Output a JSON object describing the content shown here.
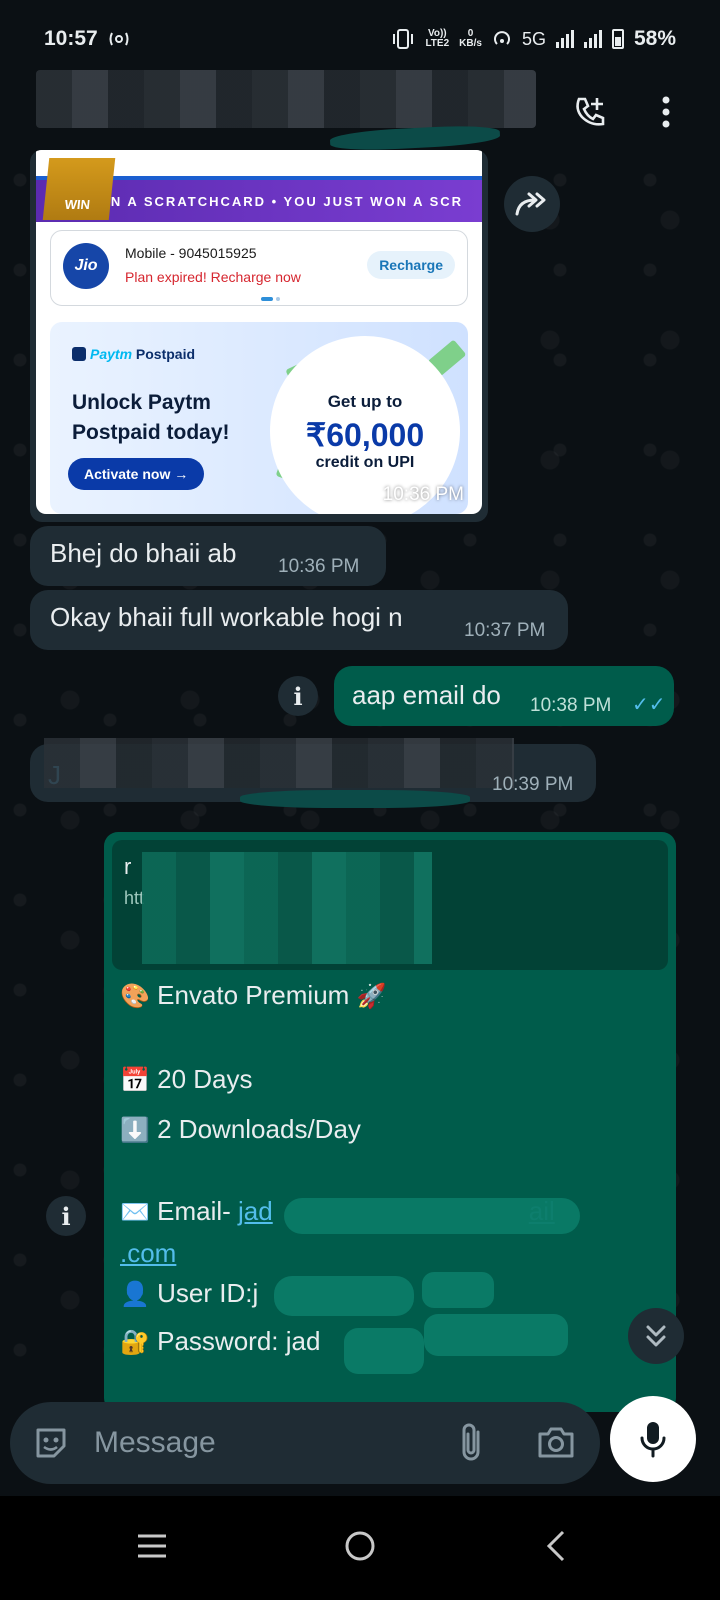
{
  "status_bar": {
    "time": "10:57",
    "volte": "Vo))",
    "lte": "LTE2",
    "speed_value": "0",
    "speed_unit": "KB/s",
    "network": "5G",
    "battery": "58%"
  },
  "media_card": {
    "ticker_text": "J   N A SCRATCHCARD • YOU JUST WON A SCR",
    "scratch_label": "WIN",
    "jio": {
      "logo": "Jio",
      "mobile": "Mobile - 9045015925",
      "status": "Plan expired! Recharge now",
      "button": "Recharge"
    },
    "paytm": {
      "brand": "Paytm",
      "product": "Postpaid",
      "headline": "Unlock Paytm Postpaid today!",
      "button": "Activate now →",
      "offer_prefix": "Get up to",
      "offer_amount": "₹60,000",
      "offer_suffix": "credit on UPI"
    },
    "time": "10:36 PM"
  },
  "messages": [
    {
      "text": "Bhej do bhaii ab",
      "time": "10:36 PM",
      "direction": "in"
    },
    {
      "text": "Okay bhaii full workable hogi n",
      "time": "10:37 PM",
      "direction": "in"
    },
    {
      "text": "aap email do",
      "time": "10:38 PM",
      "direction": "out",
      "ticks": "✓✓"
    },
    {
      "text": "J",
      "time": "10:39 PM",
      "direction": "in"
    }
  ],
  "long_message": {
    "quote_line1": "r",
    "quote_line2": "htt",
    "title": "Envato Premium",
    "days": "20 Days",
    "downloads": "2 Downloads/Day",
    "email_label": "Email- ",
    "email_value_start": "jad",
    "email_value_end": "ail",
    "email_value_line2": ".com",
    "user_label": "User ID:j",
    "password_label": "Password: jad"
  },
  "input": {
    "placeholder": "Message"
  },
  "colors": {
    "bg": "#0b1014",
    "incoming": "#1f2c34",
    "outgoing": "#005c4b",
    "link": "#53bdeb"
  }
}
